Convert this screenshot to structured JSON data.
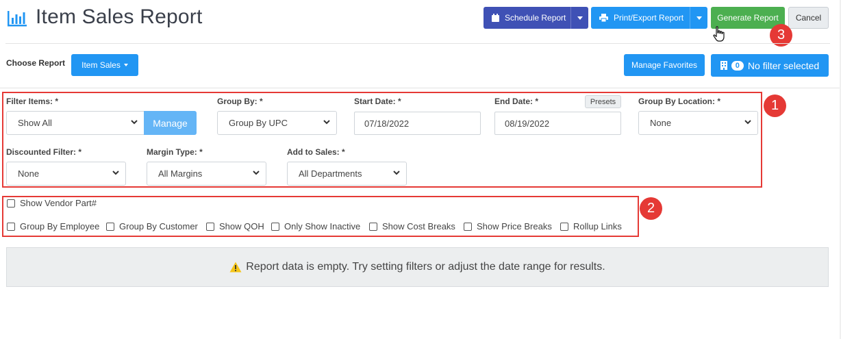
{
  "header": {
    "title": "Item Sales Report",
    "title_icon": "bar-chart-icon",
    "schedule_label": "Schedule Report",
    "print_label": "Print/Export Report",
    "generate_label": "Generate Report",
    "cancel_label": "Cancel"
  },
  "toolbar": {
    "choose_label": "Choose Report",
    "report_select_label": "Item Sales",
    "favorites_label": "Manage Favorites",
    "filter_count": "0",
    "filter_label": "No filter selected"
  },
  "filters": {
    "filter_items": {
      "label": "Filter Items: *",
      "value": "Show All",
      "manage_label": "Manage"
    },
    "group_by": {
      "label": "Group By: *",
      "value": "Group By UPC"
    },
    "start_date": {
      "label": "Start Date: *",
      "value": "07/18/2022"
    },
    "end_date": {
      "label": "End Date: *",
      "value": "08/19/2022",
      "presets_label": "Presets"
    },
    "group_by_location": {
      "label": "Group By Location: *",
      "value": "None"
    },
    "discounted": {
      "label": "Discounted Filter: *",
      "value": "None"
    },
    "margin_type": {
      "label": "Margin Type: *",
      "value": "All Margins"
    },
    "add_to_sales": {
      "label": "Add to Sales: *",
      "value": "All Departments"
    }
  },
  "options": {
    "vendor_part": "Show Vendor Part#",
    "group_employee": "Group By Employee",
    "group_customer": "Group By Customer",
    "show_qoh": "Show QOH",
    "only_inactive": "Only Show Inactive",
    "cost_breaks": "Show Cost Breaks",
    "price_breaks": "Show Price Breaks",
    "rollup_links": "Rollup Links"
  },
  "annotations": {
    "one": "1",
    "two": "2",
    "three": "3"
  },
  "message": {
    "empty": "Report data is empty. Try setting filters or adjust the date range for results."
  },
  "colors": {
    "primary": "#2196f3",
    "indigo": "#3f51b5",
    "success": "#4caf50",
    "annotation": "#e53935",
    "warning": "#f5c518"
  }
}
